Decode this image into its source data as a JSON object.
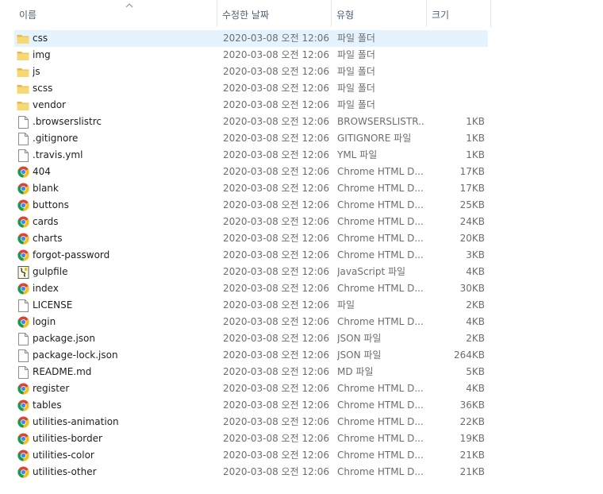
{
  "columns": {
    "name": "이름",
    "date": "수정한 날짜",
    "type": "유형",
    "size": "크기"
  },
  "sort": {
    "column": "name",
    "direction": "ascending",
    "icon": "sort-up-arrow-icon"
  },
  "files": [
    {
      "name": "css",
      "date": "2020-03-08 오전 12:06",
      "type": "파일 폴더",
      "size": "",
      "icon": "folder-icon",
      "selected": true
    },
    {
      "name": "img",
      "date": "2020-03-08 오전 12:06",
      "type": "파일 폴더",
      "size": "",
      "icon": "folder-icon"
    },
    {
      "name": "js",
      "date": "2020-03-08 오전 12:06",
      "type": "파일 폴더",
      "size": "",
      "icon": "folder-icon"
    },
    {
      "name": "scss",
      "date": "2020-03-08 오전 12:06",
      "type": "파일 폴더",
      "size": "",
      "icon": "folder-icon"
    },
    {
      "name": "vendor",
      "date": "2020-03-08 오전 12:06",
      "type": "파일 폴더",
      "size": "",
      "icon": "folder-icon"
    },
    {
      "name": ".browserslistrc",
      "date": "2020-03-08 오전 12:06",
      "type": "BROWSERSLISTR...",
      "size": "1KB",
      "icon": "file-icon"
    },
    {
      "name": ".gitignore",
      "date": "2020-03-08 오전 12:06",
      "type": "GITIGNORE 파일",
      "size": "1KB",
      "icon": "file-icon"
    },
    {
      "name": ".travis.yml",
      "date": "2020-03-08 오전 12:06",
      "type": "YML 파일",
      "size": "1KB",
      "icon": "file-icon"
    },
    {
      "name": "404",
      "date": "2020-03-08 오전 12:06",
      "type": "Chrome HTML D...",
      "size": "17KB",
      "icon": "chrome-icon"
    },
    {
      "name": "blank",
      "date": "2020-03-08 오전 12:06",
      "type": "Chrome HTML D...",
      "size": "17KB",
      "icon": "chrome-icon"
    },
    {
      "name": "buttons",
      "date": "2020-03-08 오전 12:06",
      "type": "Chrome HTML D...",
      "size": "25KB",
      "icon": "chrome-icon"
    },
    {
      "name": "cards",
      "date": "2020-03-08 오전 12:06",
      "type": "Chrome HTML D...",
      "size": "24KB",
      "icon": "chrome-icon"
    },
    {
      "name": "charts",
      "date": "2020-03-08 오전 12:06",
      "type": "Chrome HTML D...",
      "size": "20KB",
      "icon": "chrome-icon"
    },
    {
      "name": "forgot-password",
      "date": "2020-03-08 오전 12:06",
      "type": "Chrome HTML D...",
      "size": "3KB",
      "icon": "chrome-icon"
    },
    {
      "name": "gulpfile",
      "date": "2020-03-08 오전 12:06",
      "type": "JavaScript 파일",
      "size": "4KB",
      "icon": "script-icon"
    },
    {
      "name": "index",
      "date": "2020-03-08 오전 12:06",
      "type": "Chrome HTML D...",
      "size": "30KB",
      "icon": "chrome-icon"
    },
    {
      "name": "LICENSE",
      "date": "2020-03-08 오전 12:06",
      "type": "파일",
      "size": "2KB",
      "icon": "file-icon"
    },
    {
      "name": "login",
      "date": "2020-03-08 오전 12:06",
      "type": "Chrome HTML D...",
      "size": "4KB",
      "icon": "chrome-icon"
    },
    {
      "name": "package.json",
      "date": "2020-03-08 오전 12:06",
      "type": "JSON 파일",
      "size": "2KB",
      "icon": "file-icon"
    },
    {
      "name": "package-lock.json",
      "date": "2020-03-08 오전 12:06",
      "type": "JSON 파일",
      "size": "264KB",
      "icon": "file-icon"
    },
    {
      "name": "README.md",
      "date": "2020-03-08 오전 12:06",
      "type": "MD 파일",
      "size": "5KB",
      "icon": "file-icon"
    },
    {
      "name": "register",
      "date": "2020-03-08 오전 12:06",
      "type": "Chrome HTML D...",
      "size": "4KB",
      "icon": "chrome-icon"
    },
    {
      "name": "tables",
      "date": "2020-03-08 오전 12:06",
      "type": "Chrome HTML D...",
      "size": "36KB",
      "icon": "chrome-icon"
    },
    {
      "name": "utilities-animation",
      "date": "2020-03-08 오전 12:06",
      "type": "Chrome HTML D...",
      "size": "22KB",
      "icon": "chrome-icon"
    },
    {
      "name": "utilities-border",
      "date": "2020-03-08 오전 12:06",
      "type": "Chrome HTML D...",
      "size": "19KB",
      "icon": "chrome-icon"
    },
    {
      "name": "utilities-color",
      "date": "2020-03-08 오전 12:06",
      "type": "Chrome HTML D...",
      "size": "21KB",
      "icon": "chrome-icon"
    },
    {
      "name": "utilities-other",
      "date": "2020-03-08 오전 12:06",
      "type": "Chrome HTML D...",
      "size": "21KB",
      "icon": "chrome-icon"
    }
  ],
  "colors": {
    "header_text": "#4c607a",
    "selection": "#e5f3ff",
    "folder": "#f8d775",
    "muted_text": "#6d6d6d"
  }
}
